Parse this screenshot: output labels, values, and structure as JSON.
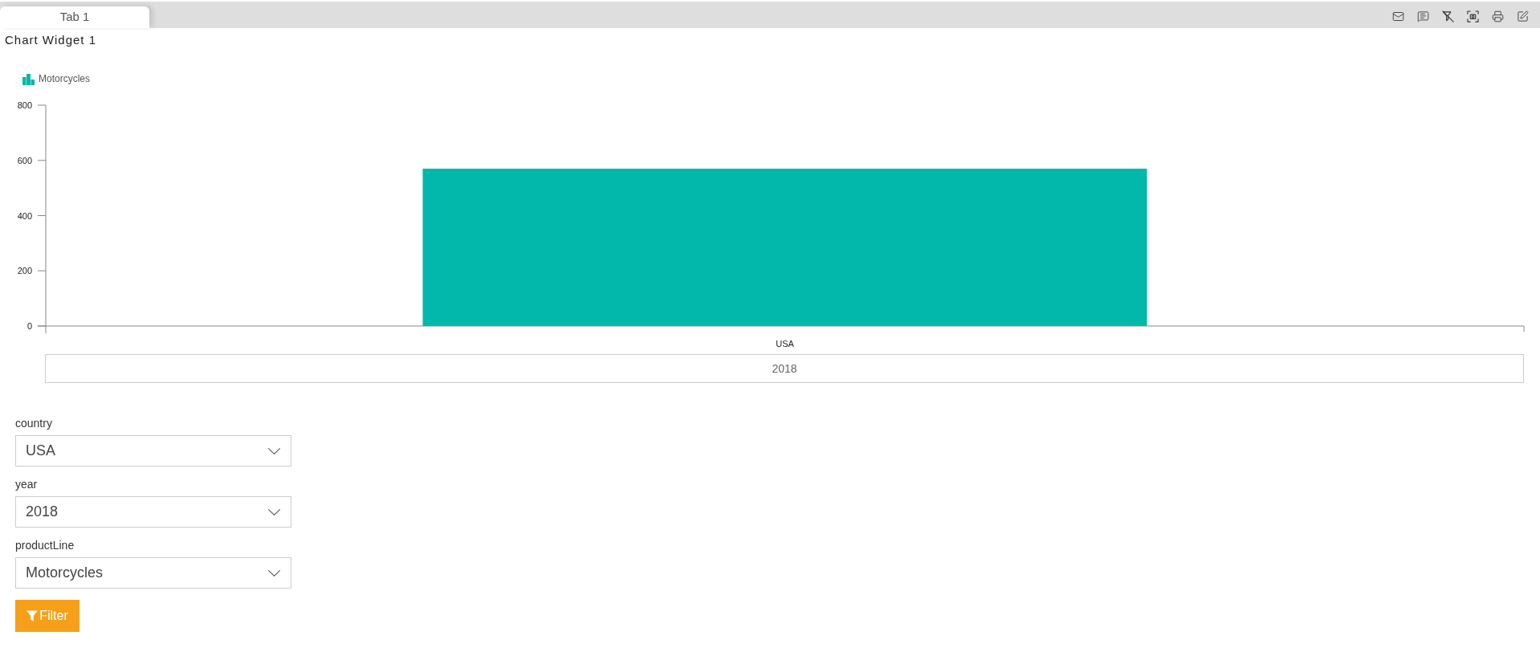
{
  "tabs": [
    {
      "label": "Tab 1",
      "selected": true
    }
  ],
  "widget": {
    "title": "Chart Widget 1"
  },
  "chart": {
    "chart_data": {
      "type": "bar",
      "categories": [
        "USA"
      ],
      "series": [
        {
          "name": "Motorcycles",
          "color": "#01b8aa",
          "values": [
            570
          ]
        }
      ],
      "ylim": [
        0,
        800
      ],
      "yticks": [
        0,
        200,
        400,
        600,
        800
      ]
    },
    "group_label": "2018"
  },
  "filters": [
    {
      "label": "country",
      "value": "USA"
    },
    {
      "label": "year",
      "value": "2018"
    },
    {
      "label": "productLine",
      "value": "Motorcycles"
    }
  ],
  "filter_button": {
    "label": "Filter"
  }
}
